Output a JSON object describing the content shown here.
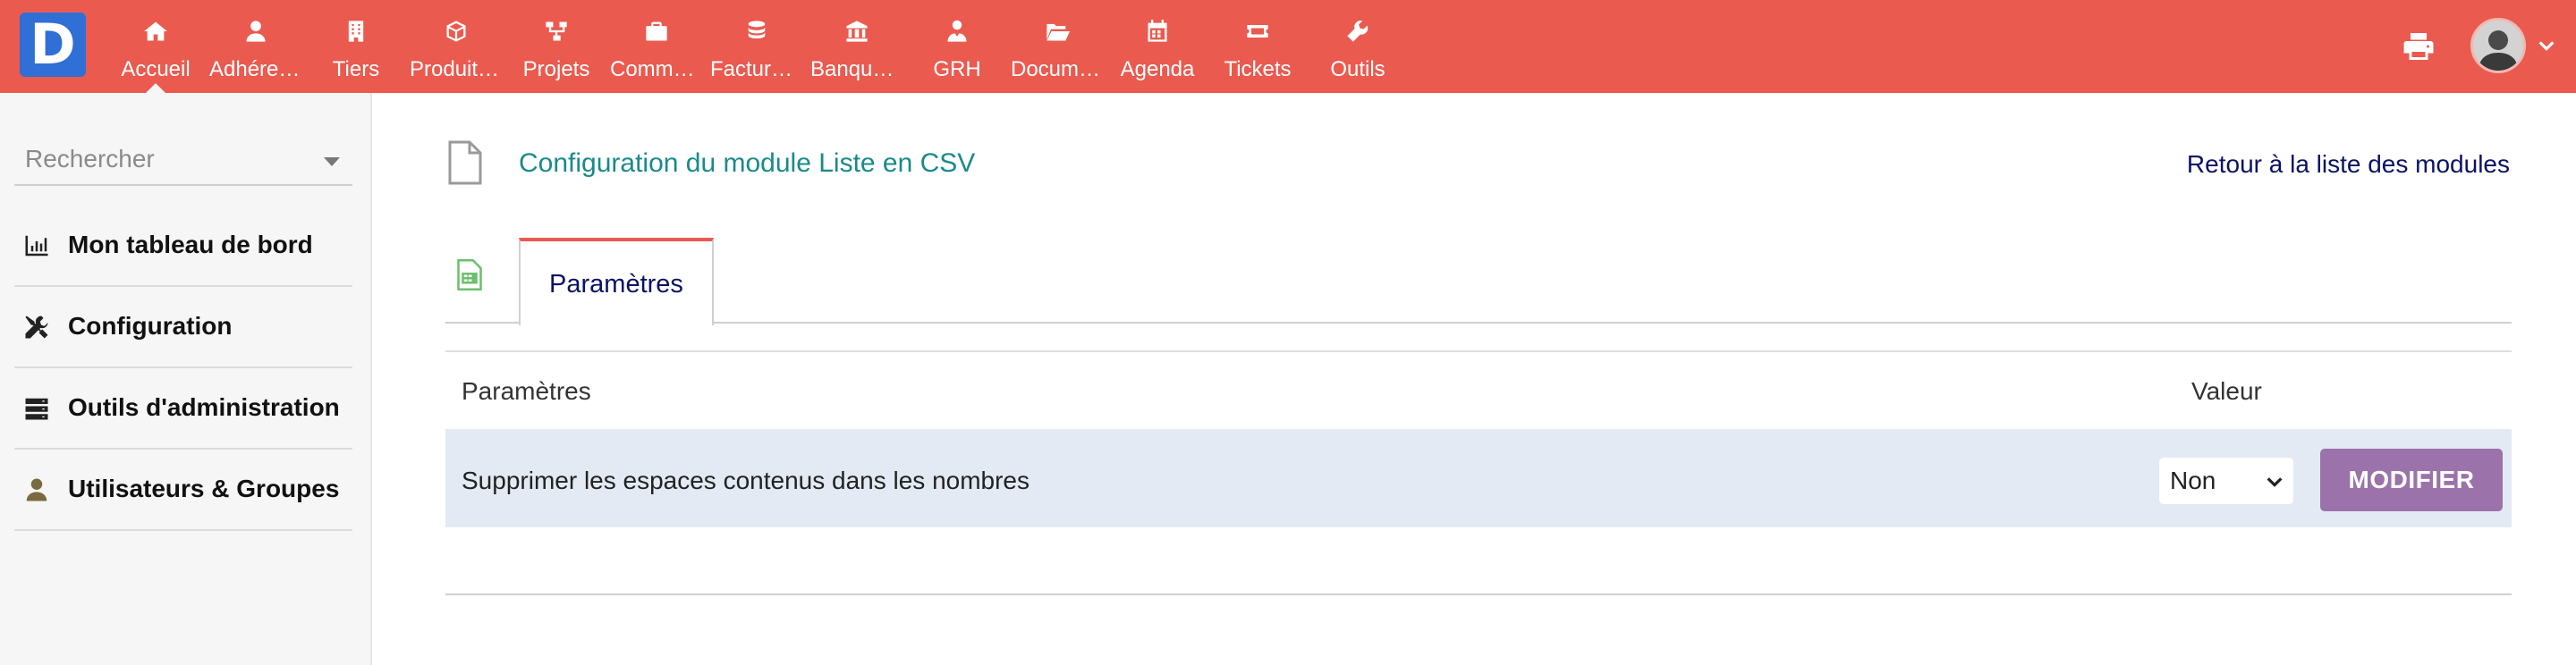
{
  "app": {
    "logo_letter": "D"
  },
  "topbar": {
    "menu": [
      {
        "label": "Accueil",
        "icon": "home-icon",
        "active": true
      },
      {
        "label": "Adhérents",
        "icon": "member-icon"
      },
      {
        "label": "Tiers",
        "icon": "building-icon"
      },
      {
        "label": "Produits | Services",
        "icon": "cube-icon"
      },
      {
        "label": "Projets",
        "icon": "project-icon"
      },
      {
        "label": "Commercial",
        "icon": "briefcase-icon"
      },
      {
        "label": "Facturation | Paiement",
        "icon": "coins-icon"
      },
      {
        "label": "Banques | Caisses",
        "icon": "bank-icon"
      },
      {
        "label": "GRH",
        "icon": "user-tie-icon"
      },
      {
        "label": "Documents",
        "icon": "folder-open-icon"
      },
      {
        "label": "Agenda",
        "icon": "calendar-icon"
      },
      {
        "label": "Tickets",
        "icon": "ticket-icon"
      },
      {
        "label": "Outils",
        "icon": "wrench-icon"
      }
    ],
    "print_icon": "print-icon",
    "user_icon": "user-avatar"
  },
  "sidebar": {
    "search_placeholder": "Rechercher",
    "items": [
      {
        "label": "Mon tableau de bord",
        "icon": "chart-bar-icon"
      },
      {
        "label": "Configuration",
        "icon": "tools-icon"
      },
      {
        "label": "Outils d'administration",
        "icon": "server-icon"
      },
      {
        "label": "Utilisateurs & Groupes",
        "icon": "user-icon"
      }
    ]
  },
  "main": {
    "title": "Configuration du module Liste en CSV",
    "back_link": "Retour à la liste des modules",
    "tab_label": "Paramètres",
    "table": {
      "headers": {
        "param": "Paramètres",
        "value": "Valeur"
      },
      "rows": [
        {
          "label": "Supprimer les espaces contenus dans les nombres",
          "value": "Non",
          "button": "MODIFIER"
        }
      ]
    }
  },
  "colors": {
    "topbar": "#ea5a4f",
    "title": "#1a8a8a",
    "link": "#0a1264",
    "button": "#9b72aa",
    "row": "#e3eaf3",
    "logo": "#2f6fd6"
  }
}
